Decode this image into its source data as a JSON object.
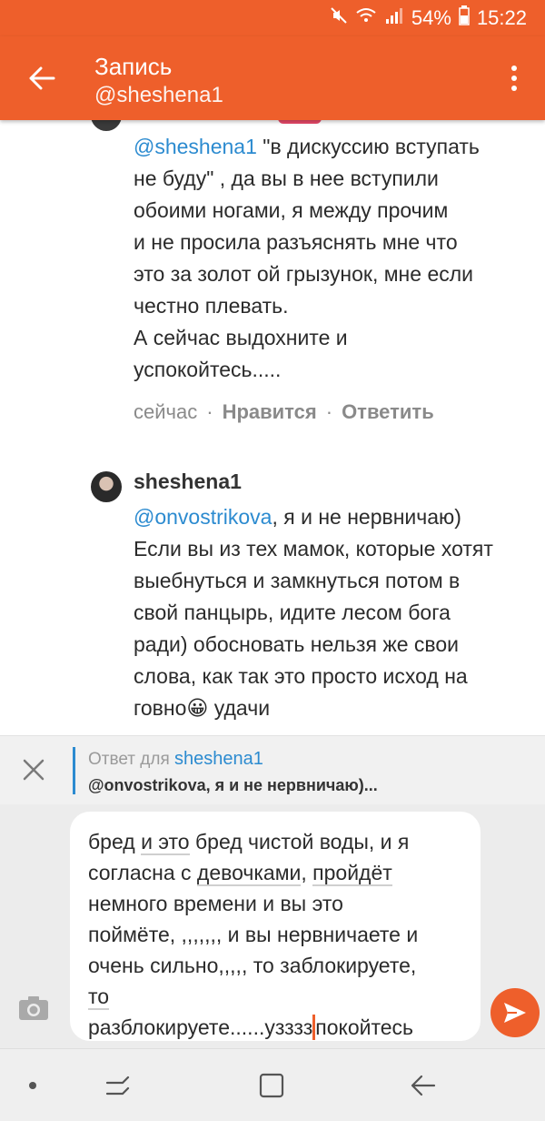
{
  "status_bar": {
    "battery_percent": "54%",
    "time": "15:22"
  },
  "app_bar": {
    "title": "Запись",
    "subtitle": "@sheshena1"
  },
  "comments": [
    {
      "mention": "@sheshena1",
      "lines": [
        " \"в дискуссию вступать",
        "не буду\"  , да вы в нее вступили",
        "обоими ногами,  я между  прочим",
        "и не просила разъяснять мне  что",
        "это за золот ой грызунок, мне если",
        "честно плевать.",
        "А сейчас выдохните и",
        "успокойтесь....."
      ],
      "time": "сейчас",
      "like_label": "Нравится",
      "reply_label": "Ответить"
    },
    {
      "author": "sheshena1",
      "mention": "@onvostrikova",
      "lines": [
        ", я и не нервничаю)",
        "Если вы из тех мамок, которые хотят",
        "выебнуться и замкнуться потом в",
        "свой панцырь, идите лесом бога",
        "ради) обосновать нельзя же свои",
        "слова, как так это просто исход на",
        "говно",
        " удачи"
      ],
      "emoji": "😀"
    }
  ],
  "reply_bar": {
    "prefix": "Ответ для",
    "name": "sheshena1",
    "quote": "@onvostrikova, я и не нервничаю)..."
  },
  "composer": {
    "lines": [
      "бред ",
      "и это",
      " бред чистой воды, и я",
      "согласна с ",
      "девочками",
      ",  ",
      "пройдёт",
      "немного времени и вы это",
      "поймёте,  ,,,,,,, и вы нервничаете и",
      "очень сильно,,,,, то заблокируете,",
      "то",
      "разблокируете......узззз",
      "покойтесь"
    ]
  },
  "colors": {
    "accent": "#ee5f2b",
    "link": "#2c8bd0"
  }
}
